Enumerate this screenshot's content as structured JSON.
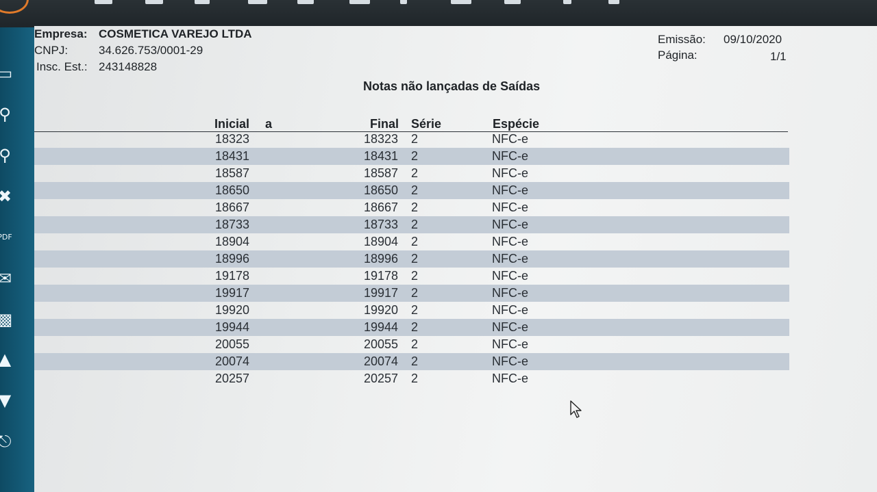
{
  "header": {
    "empresa_label": "Empresa:",
    "empresa_value": "COSMETICA VAREJO LTDA",
    "cnpj_label": "CNPJ:",
    "cnpj_value": "34.626.753/0001-29",
    "insc_label": "Insc. Est.:",
    "insc_value": "243148828",
    "emissao_label": "Emissão:",
    "emissao_value": "09/10/2020",
    "pagina_label": "Página:",
    "pagina_value": "1/1"
  },
  "report_title": "Notas não lançadas de Saídas",
  "columns": {
    "inicial": "Inicial",
    "a": "a",
    "final": "Final",
    "serie": "Série",
    "especie": "Espécie"
  },
  "rows": [
    {
      "inicial": "18323",
      "final": "18323",
      "serie": "2",
      "especie": "NFC-e"
    },
    {
      "inicial": "18431",
      "final": "18431",
      "serie": "2",
      "especie": "NFC-e"
    },
    {
      "inicial": "18587",
      "final": "18587",
      "serie": "2",
      "especie": "NFC-e"
    },
    {
      "inicial": "18650",
      "final": "18650",
      "serie": "2",
      "especie": "NFC-e"
    },
    {
      "inicial": "18667",
      "final": "18667",
      "serie": "2",
      "especie": "NFC-e"
    },
    {
      "inicial": "18733",
      "final": "18733",
      "serie": "2",
      "especie": "NFC-e"
    },
    {
      "inicial": "18904",
      "final": "18904",
      "serie": "2",
      "especie": "NFC-e"
    },
    {
      "inicial": "18996",
      "final": "18996",
      "serie": "2",
      "especie": "NFC-e"
    },
    {
      "inicial": "19178",
      "final": "19178",
      "serie": "2",
      "especie": "NFC-e"
    },
    {
      "inicial": "19917",
      "final": "19917",
      "serie": "2",
      "especie": "NFC-e"
    },
    {
      "inicial": "19920",
      "final": "19920",
      "serie": "2",
      "especie": "NFC-e"
    },
    {
      "inicial": "19944",
      "final": "19944",
      "serie": "2",
      "especie": "NFC-e"
    },
    {
      "inicial": "20055",
      "final": "20055",
      "serie": "2",
      "especie": "NFC-e"
    },
    {
      "inicial": "20074",
      "final": "20074",
      "serie": "2",
      "especie": "NFC-e"
    },
    {
      "inicial": "20257",
      "final": "20257",
      "serie": "2",
      "especie": "NFC-e"
    }
  ],
  "sidebar": {
    "icons": [
      "document-icon",
      "zoom-icon",
      "search-page-icon",
      "excel-icon",
      "pdf-icon",
      "email-icon",
      "save-icon",
      "arrow-up-icon",
      "arrow-down-icon",
      "attachment-icon"
    ]
  },
  "colors": {
    "sidebar": "#155d7a",
    "stripe": "#c3ccd6",
    "toolbar": "#2a3135",
    "logo": "#e07a2a"
  }
}
